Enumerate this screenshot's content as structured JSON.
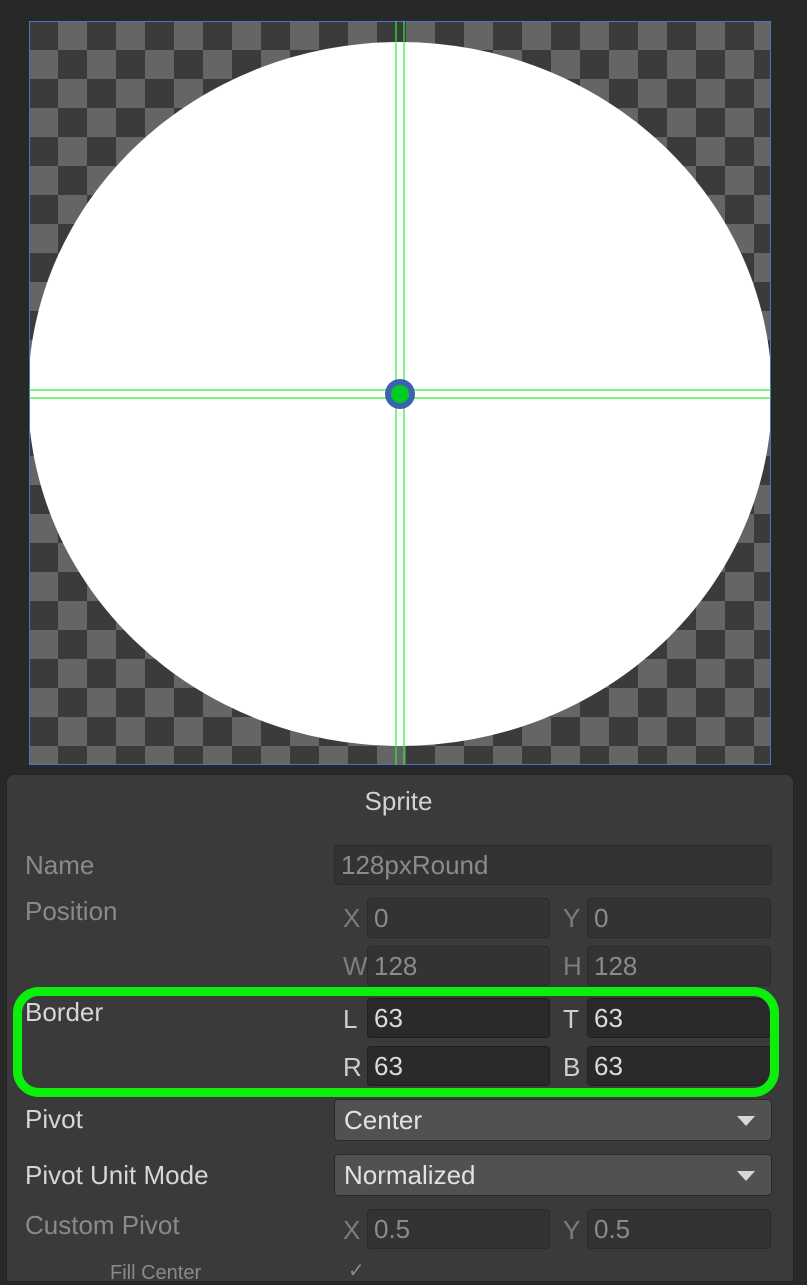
{
  "panel_title": "Sprite",
  "name": {
    "label": "Name",
    "value": "128pxRound"
  },
  "position": {
    "label": "Position",
    "x": {
      "label": "X",
      "value": "0"
    },
    "y": {
      "label": "Y",
      "value": "0"
    },
    "w": {
      "label": "W",
      "value": "128"
    },
    "h": {
      "label": "H",
      "value": "128"
    }
  },
  "border": {
    "label": "Border",
    "l": {
      "label": "L",
      "value": "63"
    },
    "t": {
      "label": "T",
      "value": "63"
    },
    "r": {
      "label": "R",
      "value": "63"
    },
    "b": {
      "label": "B",
      "value": "63"
    }
  },
  "pivot": {
    "label": "Pivot",
    "value": "Center"
  },
  "pivot_unit_mode": {
    "label": "Pivot Unit Mode",
    "value": "Normalized"
  },
  "custom_pivot": {
    "label": "Custom Pivot",
    "x": {
      "label": "X",
      "value": "0.5"
    },
    "y": {
      "label": "Y",
      "value": "0.5"
    }
  },
  "footer": {
    "fill_center_label": "Fill Center",
    "fill_center_check": "✓"
  },
  "colors": {
    "highlight": "#0cee0c",
    "guide": "#33ee33",
    "pivot_handle": "#00cc22"
  }
}
